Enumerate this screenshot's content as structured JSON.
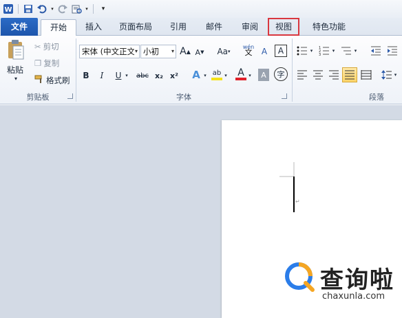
{
  "qat": {
    "icons": [
      "word-logo-icon",
      "save-icon",
      "undo-icon",
      "redo-icon",
      "print-preview-icon",
      "customize-icon"
    ]
  },
  "tabs": [
    {
      "label": "文件",
      "name": "tab-file"
    },
    {
      "label": "开始",
      "name": "tab-home"
    },
    {
      "label": "插入",
      "name": "tab-insert"
    },
    {
      "label": "页面布局",
      "name": "tab-page-layout"
    },
    {
      "label": "引用",
      "name": "tab-references"
    },
    {
      "label": "邮件",
      "name": "tab-mailings"
    },
    {
      "label": "审阅",
      "name": "tab-review"
    },
    {
      "label": "视图",
      "name": "tab-view"
    },
    {
      "label": "特色功能",
      "name": "tab-features"
    }
  ],
  "clipboard": {
    "paste": "粘贴",
    "cut": "剪切",
    "copy": "复制",
    "format_painter": "格式刷",
    "group": "剪贴板"
  },
  "font": {
    "font_name": "宋体 (中文正文)",
    "font_size": "小初",
    "group": "字体",
    "bold": "B",
    "italic": "I",
    "underline": "U",
    "strike": "abc",
    "subscript": "x₂",
    "superscript": "x²",
    "grow": "A",
    "shrink": "A",
    "change_case": "Aa",
    "clear": "A",
    "text_effect": "A",
    "font_color": "A",
    "char_shade": "A",
    "enclose": "字",
    "phonetic": "wén",
    "highlight": "ab"
  },
  "paragraph": {
    "group": "段落"
  },
  "watermark": {
    "brand": "查询啦",
    "url": "chaxunla.com"
  },
  "colors": {
    "file_tab": "#1d55ac",
    "highlight_box": "#d9363e",
    "font_color_bar": "#e0202a",
    "highlight_bar": "#f5e21a",
    "logo_orange": "#f5a623",
    "logo_blue": "#2b7de9"
  }
}
